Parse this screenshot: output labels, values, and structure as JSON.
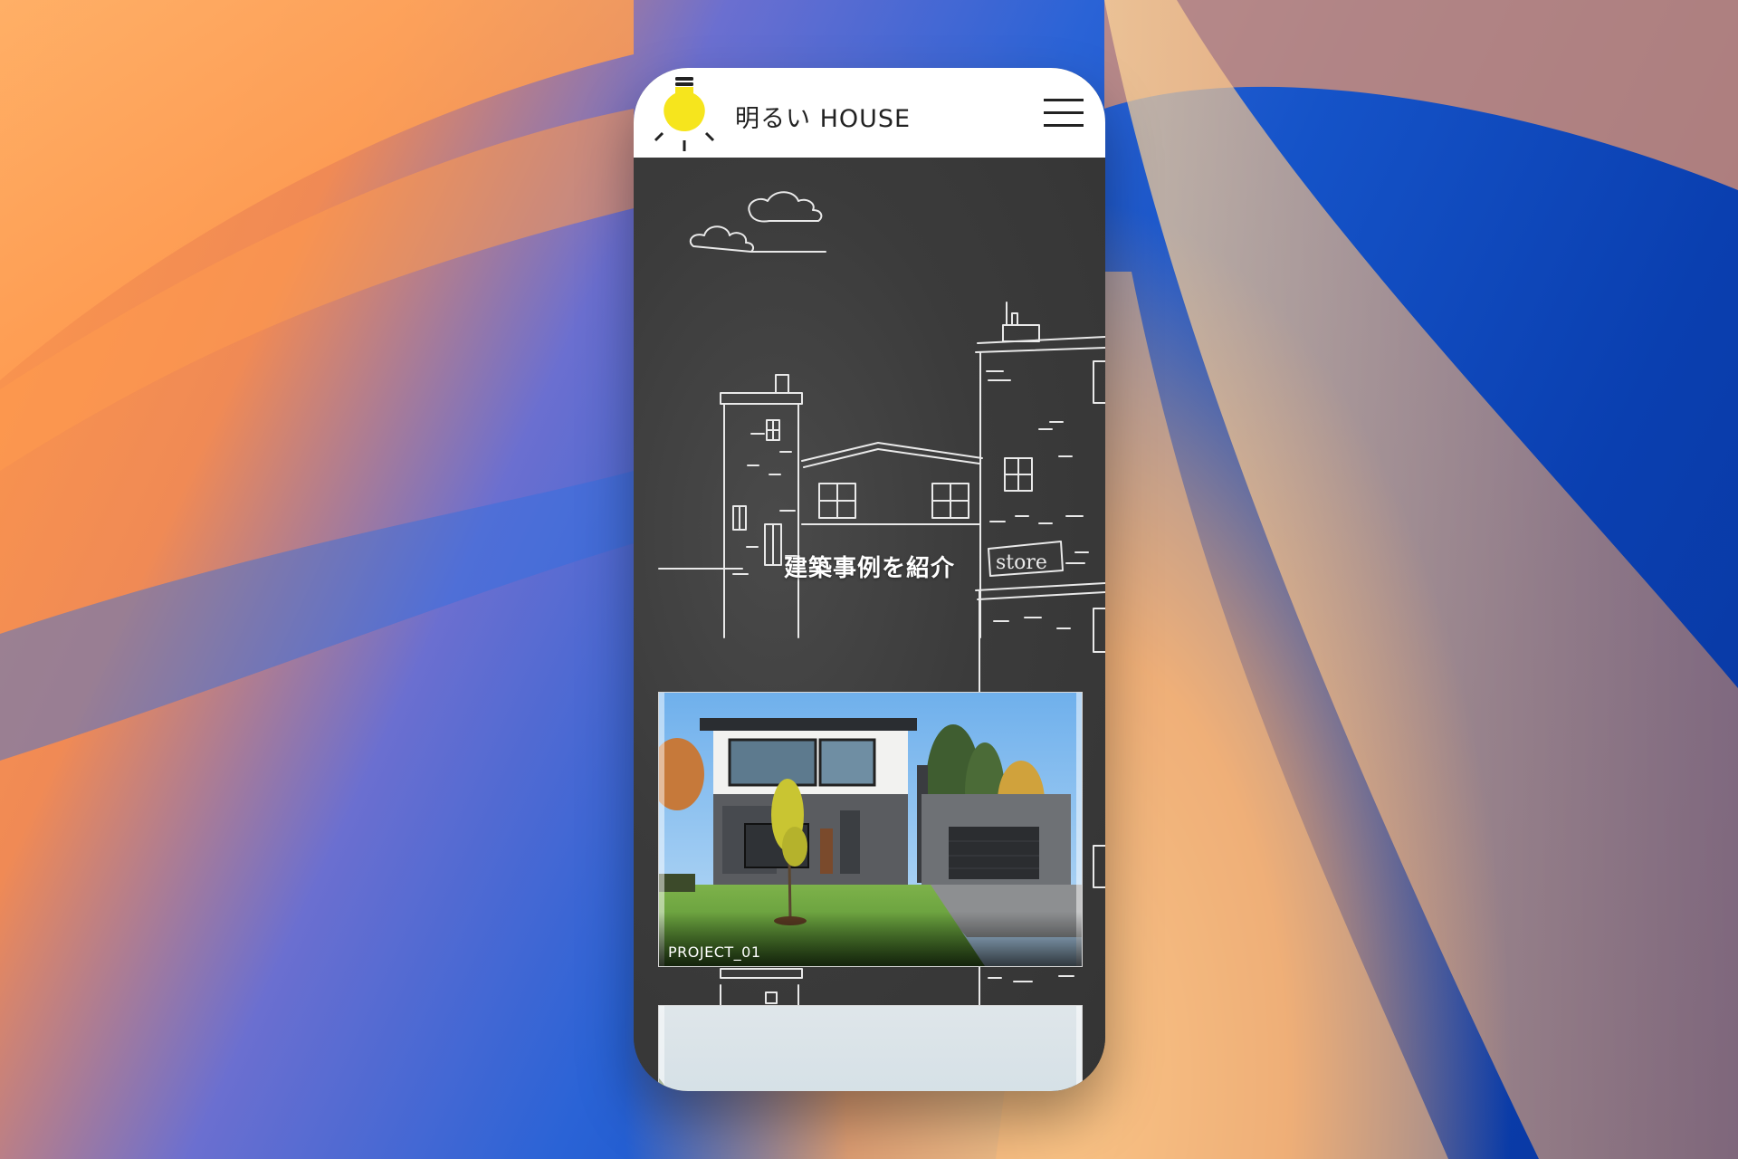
{
  "header": {
    "site_title": "明るい HOUSE",
    "logo_icon": "lightbulb-icon",
    "menu_icon": "hamburger-menu-icon"
  },
  "hero": {
    "section_title": "建築事例を紹介",
    "chalk_sign": "store"
  },
  "projects": [
    {
      "label": "PROJECT_01"
    },
    {
      "label": ""
    }
  ],
  "colors": {
    "accent_yellow": "#f6e51d",
    "chalkboard": "#3b3b3b"
  }
}
